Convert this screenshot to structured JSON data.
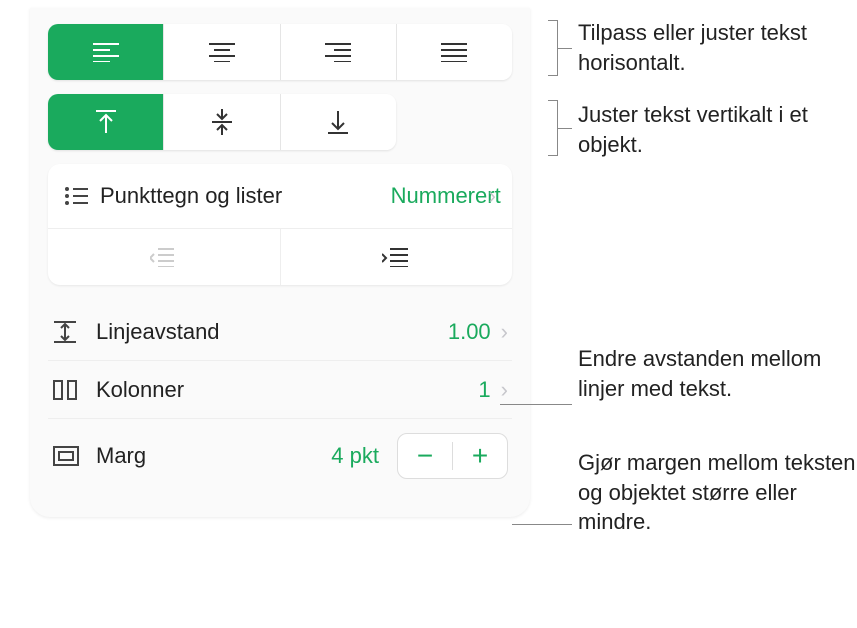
{
  "bullets": {
    "label": "Punkttegn og lister",
    "value": "Nummerert"
  },
  "lineSpacing": {
    "label": "Linjeavstand",
    "value": "1.00"
  },
  "columns": {
    "label": "Kolonner",
    "value": "1"
  },
  "margin": {
    "label": "Marg",
    "value": "4 pkt"
  },
  "callouts": {
    "horizontal": "Tilpass eller juster tekst horisontalt.",
    "vertical": "Juster tekst vertikalt i et objekt.",
    "lineSpacing": "Endre avstanden mellom linjer med tekst.",
    "margin": "Gjør margen mellom teksten og objektet større eller mindre."
  }
}
